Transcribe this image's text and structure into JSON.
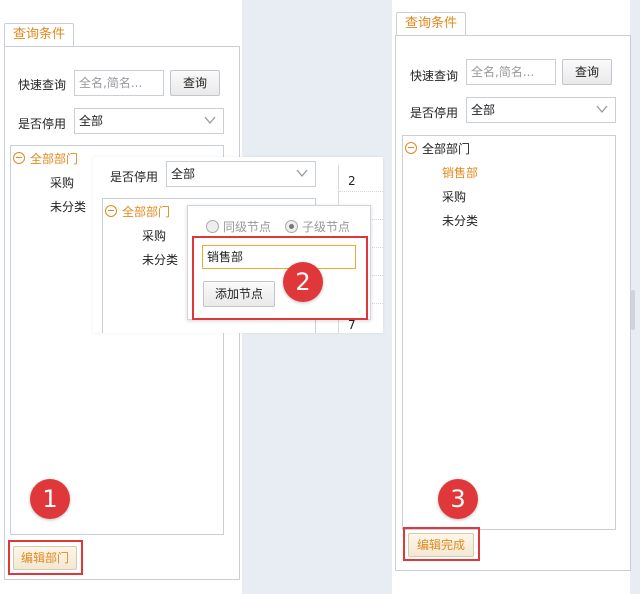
{
  "left_panel": {
    "tab_label": "查询条件",
    "quick_search_label": "快速查询",
    "quick_search_placeholder": "全名,简名...",
    "query_button": "查询",
    "disabled_label": "是否停用",
    "disabled_value": "全部",
    "tree": {
      "root": "全部部门",
      "children": [
        "采购",
        "未分类"
      ]
    },
    "edit_button": "编辑部门",
    "step_badge": "1"
  },
  "popup": {
    "disabled_label": "是否停用",
    "disabled_value": "全部",
    "tree": {
      "root": "全部部门",
      "children": [
        "采购",
        "未分类"
      ]
    },
    "radio_sibling": "同级节点",
    "radio_child": "子级节点",
    "node_name_value": "销售部",
    "add_node_button": "添加节点",
    "step_badge": "2",
    "grid_numbers": [
      "2",
      "7"
    ]
  },
  "right_panel": {
    "tab_label": "查询条件",
    "quick_search_label": "快速查询",
    "quick_search_placeholder": "全名,简名...",
    "query_button": "查询",
    "disabled_label": "是否停用",
    "disabled_value": "全部",
    "tree": {
      "root": "全部部门",
      "children": [
        "销售部",
        "采购",
        "未分类"
      ]
    },
    "done_button": "编辑完成",
    "step_badge": "3"
  },
  "colors": {
    "accent": "#e08a1e",
    "highlight": "#e0383a",
    "border": "#c9cfd8"
  }
}
